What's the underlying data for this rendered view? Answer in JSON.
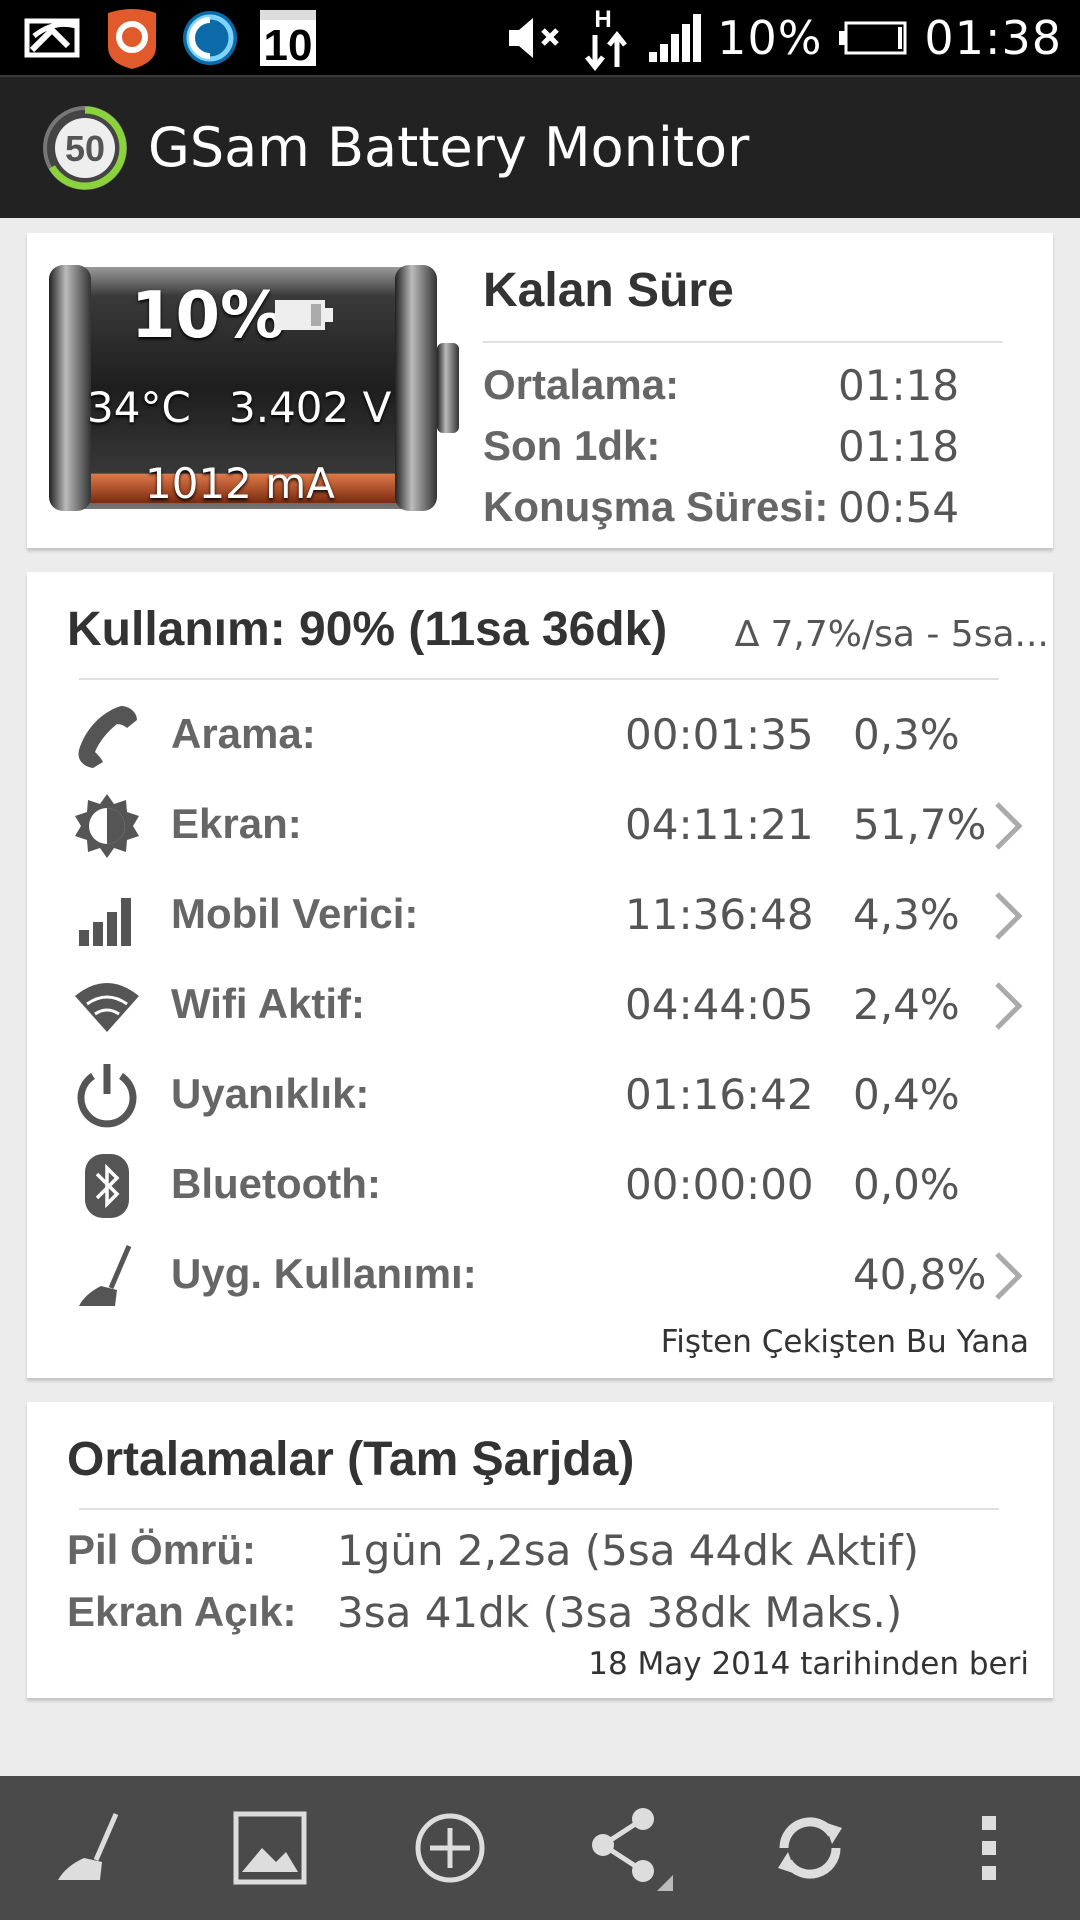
{
  "status_bar": {
    "notification_icons": [
      "photo-icon",
      "app-orange-icon",
      "app-blue-icon",
      "calendar-10-icon"
    ],
    "calendar_day": "10",
    "network_label": "H",
    "battery_percent": "10%",
    "time": "01:38"
  },
  "app_bar": {
    "logo_value": "50",
    "title": "GSam Battery Monitor"
  },
  "battery_card": {
    "level": "10%",
    "level_fraction": 0.1,
    "temperature": "34°C",
    "voltage": "3.402 V",
    "current": "1012 mA",
    "remaining": {
      "title": "Kalan Süre",
      "rows": [
        {
          "label": "Ortalama:",
          "value": "01:18"
        },
        {
          "label": "Son 1dk:",
          "value": "01:18"
        },
        {
          "label": "Konuşma Süresi:",
          "value": "00:54"
        }
      ]
    }
  },
  "usage_card": {
    "title": "Kullanım: 90% (11sa 36dk)",
    "rate": "∆ 7,7%/sa - 5sa...",
    "rows": [
      {
        "icon": "phone-icon",
        "label": "Arama:",
        "time": "00:01:35",
        "percent": "0,3%",
        "has_detail": false
      },
      {
        "icon": "brightness-icon",
        "label": "Ekran:",
        "time": "04:11:21",
        "percent": "51,7%",
        "has_detail": true
      },
      {
        "icon": "signal-icon",
        "label": "Mobil Verici:",
        "time": "11:36:48",
        "percent": "4,3%",
        "has_detail": true
      },
      {
        "icon": "wifi-icon",
        "label": "Wifi Aktif:",
        "time": "04:44:05",
        "percent": "2,4%",
        "has_detail": true
      },
      {
        "icon": "power-icon",
        "label": "Uyanıklık:",
        "time": "01:16:42",
        "percent": "0,4%",
        "has_detail": false
      },
      {
        "icon": "bluetooth-icon",
        "label": "Bluetooth:",
        "time": "00:00:00",
        "percent": "0,0%",
        "has_detail": false
      },
      {
        "icon": "broom-icon",
        "label": "Uyg. Kullanımı:",
        "time": "",
        "percent": "40,8%",
        "has_detail": true
      }
    ],
    "footer": "Fişten Çekişten Bu Yana"
  },
  "averages_card": {
    "title": "Ortalamalar (Tam Şarjda)",
    "rows": [
      {
        "label": "Pil Ömrü:",
        "value": "1gün 2,2sa (5sa 44dk Aktif)"
      },
      {
        "label": "Ekran Açık:",
        "value": "3sa 41dk (3sa 38dk Maks.)"
      }
    ],
    "footer": "18 May 2014 tarihinden beri"
  },
  "toolbar": {
    "buttons": [
      "broom-icon",
      "image-icon",
      "add-circle-icon",
      "share-icon",
      "refresh-icon",
      "overflow-menu-icon"
    ]
  },
  "colors": {
    "status_bar_bg": "#000000",
    "action_bar_bg": "#222222",
    "page_bg": "#ececec",
    "toolbar_bg": "#4a4a4a",
    "battery_fill": "#c8542a",
    "logo_ring": "#8bd33a"
  }
}
